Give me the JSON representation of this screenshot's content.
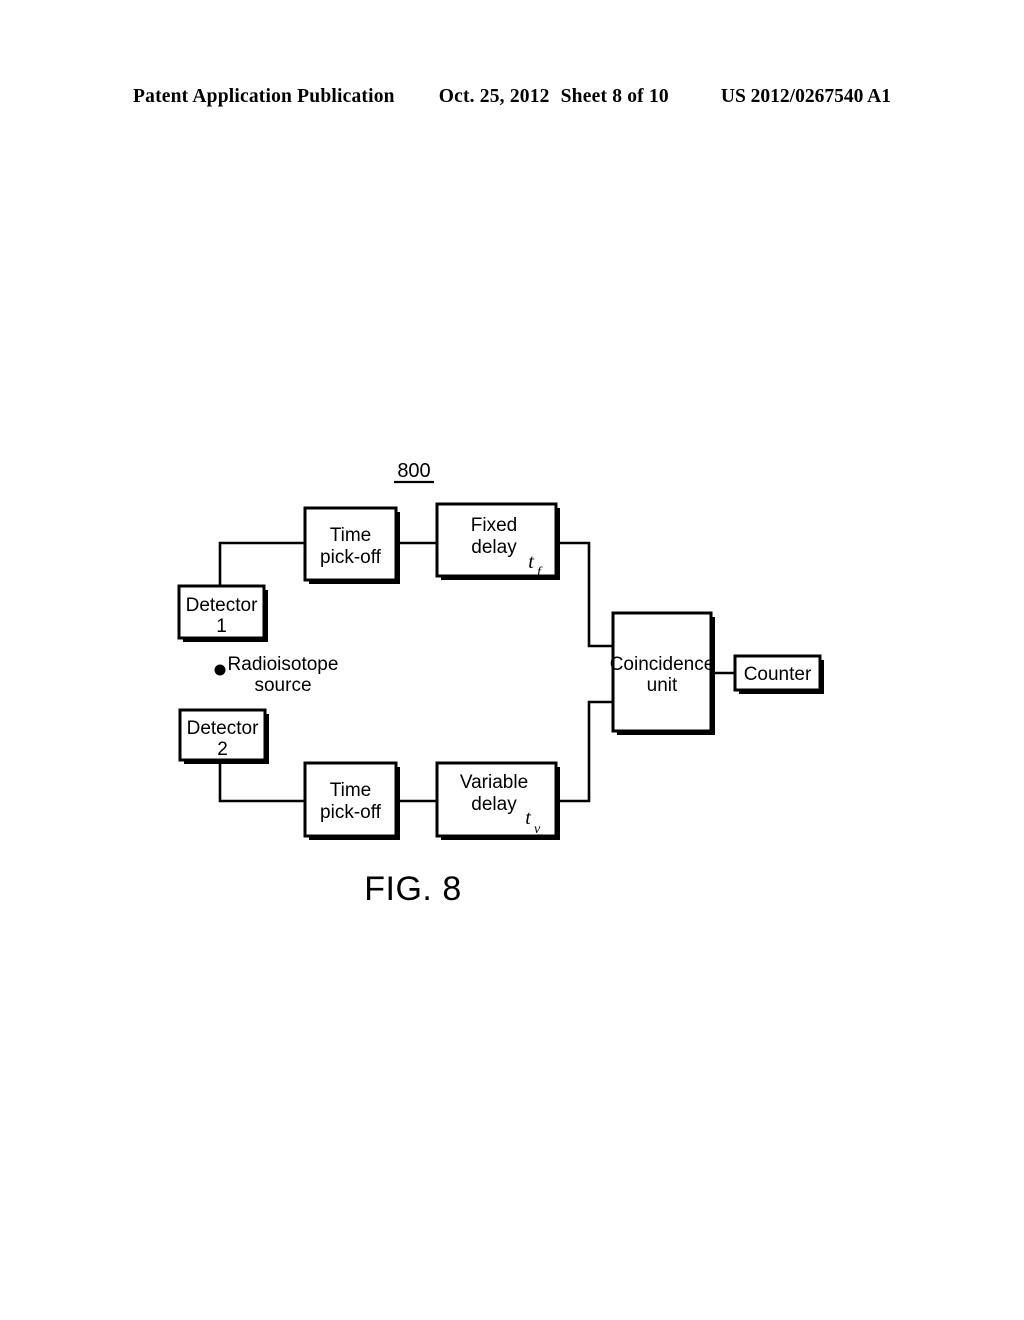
{
  "header": {
    "publication": "Patent Application Publication",
    "date": "Oct. 25, 2012",
    "sheet": "Sheet 8 of 10",
    "patent_number": "US 2012/0267540 A1"
  },
  "figure": {
    "reference_numeral": "800",
    "caption": "FIG. 8",
    "blocks": {
      "detector1": {
        "line1": "Detector",
        "line2": "1"
      },
      "detector2": {
        "line1": "Detector",
        "line2": "2"
      },
      "time_pickoff_top": {
        "line1": "Time",
        "line2": "pick-off"
      },
      "time_pickoff_bottom": {
        "line1": "Time",
        "line2": "pick-off"
      },
      "fixed_delay": {
        "line1": "Fixed",
        "line2": "delay",
        "symbol": "t",
        "subscript": "f"
      },
      "variable_delay": {
        "line1": "Variable",
        "line2": "delay",
        "symbol": "t",
        "subscript": "v"
      },
      "coincidence_unit": {
        "line1": "Coincidence",
        "line2": "unit"
      },
      "counter": {
        "line1": "Counter"
      }
    },
    "source": {
      "line1": "Radioisotope",
      "line2": "source"
    }
  },
  "colors": {
    "ink": "#000000",
    "paper": "#ffffff"
  }
}
